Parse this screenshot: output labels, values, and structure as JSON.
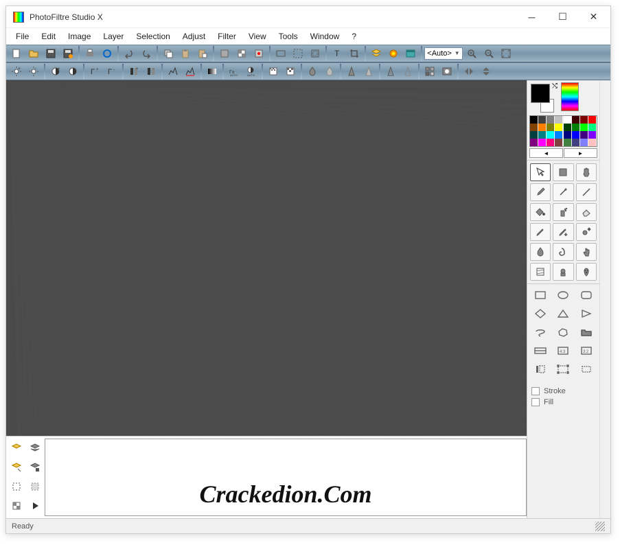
{
  "window": {
    "title": "PhotoFiltre Studio X"
  },
  "menu": {
    "items": [
      "File",
      "Edit",
      "Image",
      "Layer",
      "Selection",
      "Adjust",
      "Filter",
      "View",
      "Tools",
      "Window",
      "?"
    ]
  },
  "toolbar": {
    "zoom_value": "<Auto>",
    "row1_icons": [
      "new",
      "open",
      "save",
      "saveas",
      "print",
      "twain",
      "undo",
      "redo",
      "copy",
      "paste",
      "paste-as",
      "layer-props",
      "layer-grid",
      "layer-fx",
      "frame",
      "sel-frame",
      "text",
      "crop",
      "layers",
      "plugins",
      "explore"
    ],
    "row2_icons": [
      "bright-plus",
      "bright-minus",
      "contrast-plus",
      "contrast-minus",
      "gamma-plus",
      "gamma-minus",
      "sat-plus",
      "sat-minus",
      "histogram",
      "hist-stretch",
      "gray",
      "auto-level",
      "auto-contrast",
      "dither",
      "dither2",
      "blur",
      "blur-more",
      "sharpen",
      "sharpen-more",
      "relief",
      "relief-minus",
      "flip-h",
      "flip-v"
    ]
  },
  "palette": {
    "colors": [
      "#000000",
      "#404040",
      "#808080",
      "#c0c0c0",
      "#ffffff",
      "#400000",
      "#800000",
      "#ff0000",
      "#804000",
      "#ff8000",
      "#808000",
      "#ffff00",
      "#004000",
      "#008000",
      "#00ff00",
      "#00ff80",
      "#004040",
      "#008080",
      "#00ffff",
      "#0080ff",
      "#000080",
      "#0000ff",
      "#400080",
      "#8000ff",
      "#800080",
      "#ff00ff",
      "#ff0080",
      "#804040",
      "#408040",
      "#404080",
      "#8080ff",
      "#ffc0c0"
    ]
  },
  "tools": {
    "names": [
      "pointer",
      "selection-color",
      "hand",
      "eyedropper",
      "wand",
      "line",
      "bucket",
      "spray",
      "eraser",
      "brush",
      "brush-plus",
      "clone",
      "blur-tool",
      "smudge",
      "finger",
      "pattern",
      "portrait",
      "strawberry"
    ]
  },
  "shapes": {
    "names": [
      "rect",
      "ellipse",
      "rounded",
      "diamond",
      "triangle",
      "rtriangle",
      "lasso",
      "polygon",
      "folder",
      "wh",
      "43",
      "32",
      "text-sel",
      "node",
      "free"
    ]
  },
  "options": {
    "stroke": "Stroke",
    "fill": "Fill"
  },
  "layerbar": {
    "icons": [
      "layer-new",
      "layer-dup",
      "layer-open",
      "layer-save",
      "layer-sel",
      "layer-hide",
      "layer-checker",
      "layer-play"
    ]
  },
  "watermark": "Crackedion.Com",
  "status": {
    "text": "Ready"
  }
}
